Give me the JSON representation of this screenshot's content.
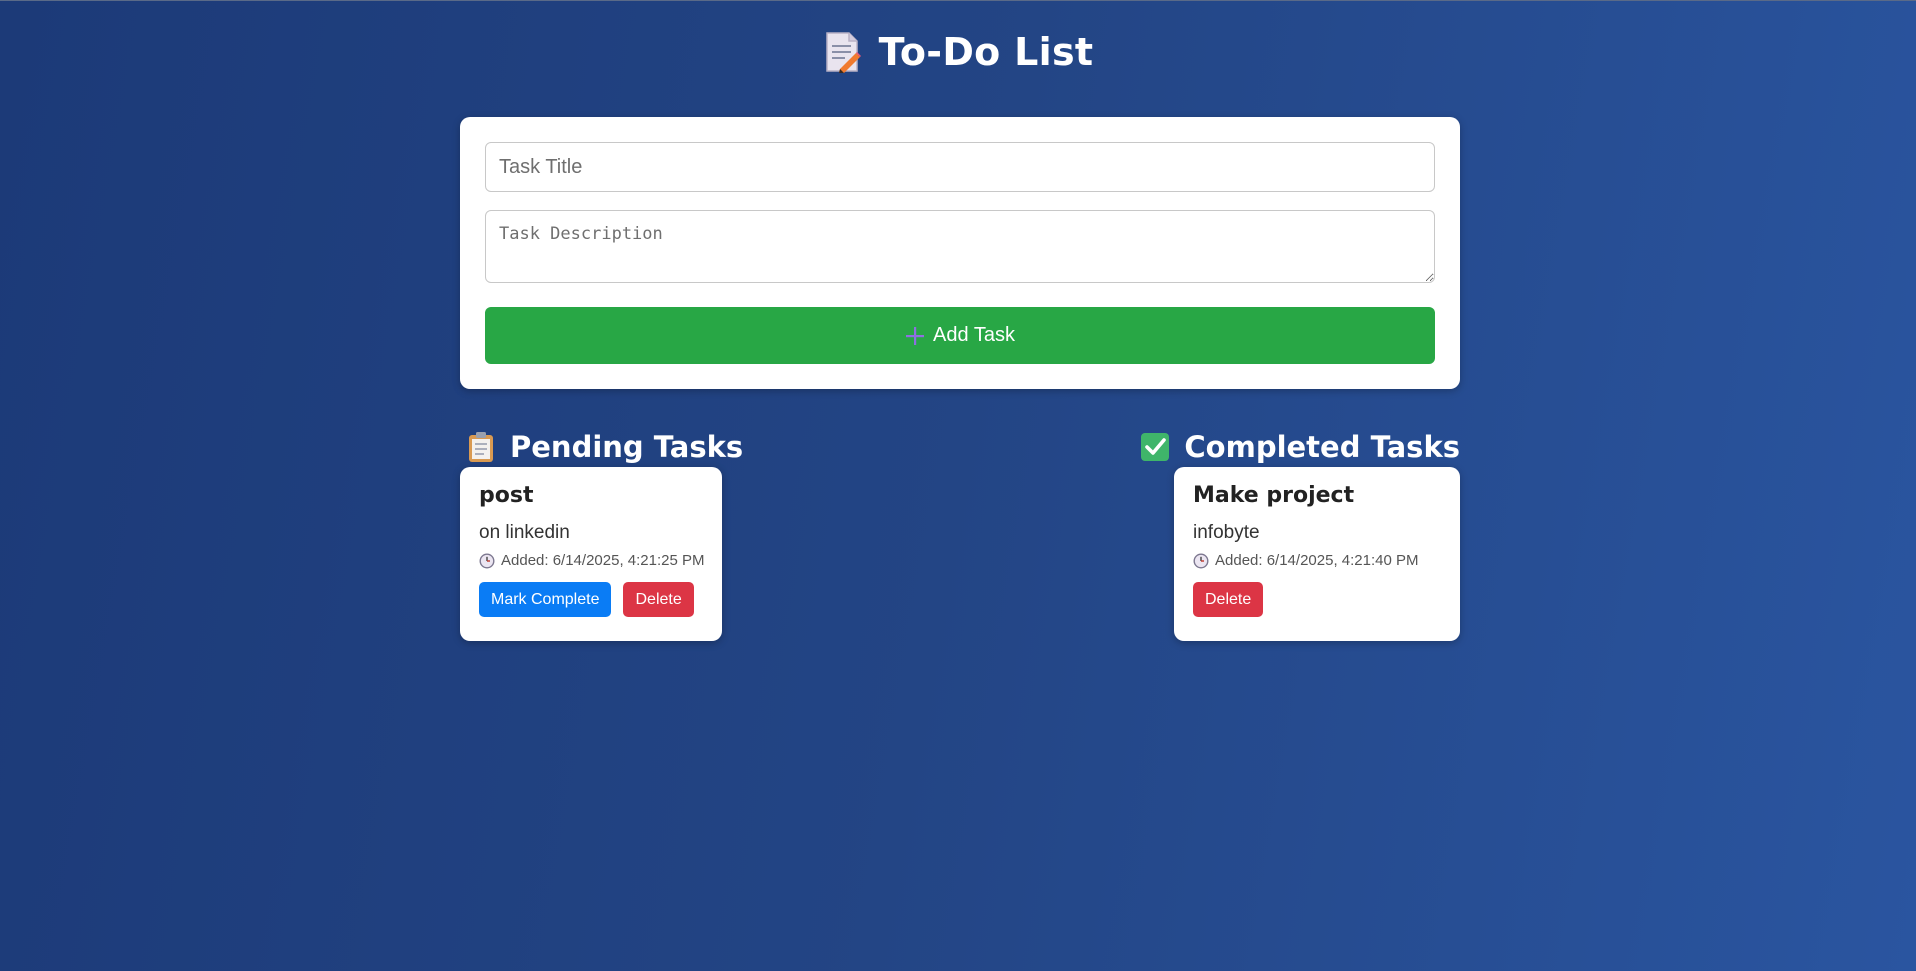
{
  "app": {
    "title": "To-Do List"
  },
  "form": {
    "title_placeholder": "Task Title",
    "title_value": "",
    "description_placeholder": "Task Description",
    "description_value": "",
    "add_button_label": "Add Task"
  },
  "pending": {
    "heading": "Pending Tasks",
    "tasks": [
      {
        "title": "post",
        "description": "on linkedin",
        "added": "Added: 6/14/2025, 4:21:25 PM",
        "complete_label": "Mark Complete",
        "delete_label": "Delete"
      }
    ]
  },
  "completed": {
    "heading": "Completed Tasks",
    "tasks": [
      {
        "title": "Make project",
        "description": "infobyte",
        "added": "Added: 6/14/2025, 4:21:40 PM",
        "delete_label": "Delete"
      }
    ]
  },
  "colors": {
    "background_start": "#1c3a78",
    "background_end": "#2a55a0",
    "add_button": "#28a745",
    "complete_button": "#0a7cf5",
    "delete_button": "#dc3545"
  },
  "icons": {
    "header": "memo-icon",
    "add": "plus-icon",
    "pending": "clipboard-icon",
    "completed": "check-mark-icon",
    "timestamp": "clock-icon"
  }
}
